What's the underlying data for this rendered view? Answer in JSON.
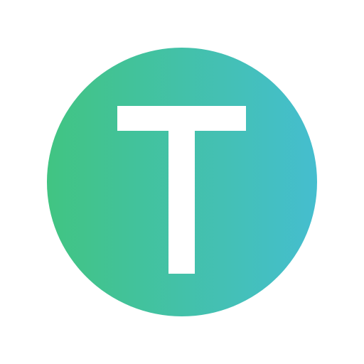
{
  "logo": {
    "letter": "T",
    "gradient_start_color": "#41C482",
    "gradient_end_color": "#45BECF",
    "letter_color": "#FFFFFF"
  }
}
